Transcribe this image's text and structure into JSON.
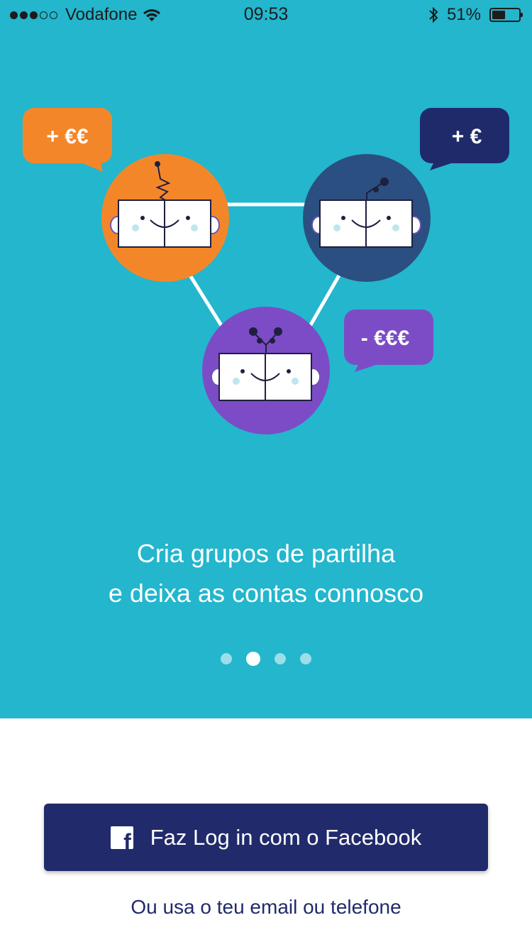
{
  "status_bar": {
    "carrier": "Vodafone",
    "signal_bars": 3,
    "signal_total": 5,
    "time": "09:53",
    "battery_percent_label": "51%",
    "battery_level": 0.51
  },
  "illustration": {
    "bubbles": [
      {
        "label": "+ €€",
        "color": "#f4862a"
      },
      {
        "label": "+ €",
        "color": "#1f2a6b"
      },
      {
        "label": "- €€€",
        "color": "#7c4cc6"
      }
    ],
    "characters": [
      {
        "color": "#f4862a"
      },
      {
        "color": "#2b4f80"
      },
      {
        "color": "#7c4cc6"
      }
    ]
  },
  "onboarding": {
    "tagline_line1": "Cria grupos de partilha",
    "tagline_line2": "e deixa as contas connosco",
    "page_count": 4,
    "active_page": 2
  },
  "auth": {
    "facebook_button_label": "Faz Log in com o Facebook",
    "alternative_link": "Ou usa o teu email ou telefone"
  },
  "colors": {
    "hero_background": "#23b6cd",
    "primary_navy": "#212a6a"
  }
}
